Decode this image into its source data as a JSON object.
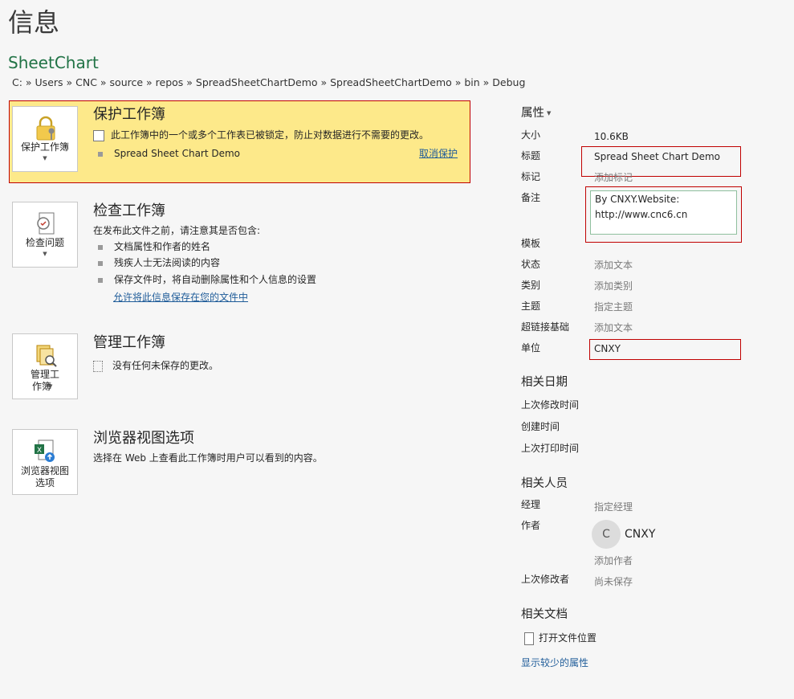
{
  "page": {
    "title": "信息"
  },
  "file": {
    "name": "SheetChart",
    "path": "C: » Users » CNC » source » repos » SpreadSheetChartDemo » SpreadSheetChartDemo » bin » Debug"
  },
  "protect": {
    "tile_label": "保护工作簿",
    "title": "保护工作簿",
    "message": "此工作簿中的一个或多个工作表已被锁定，防止对数据进行不需要的更改。",
    "sheet_name": "Spread Sheet Chart Demo",
    "unprotect_link": "取消保护"
  },
  "inspect": {
    "tile_label": "检查问题",
    "title": "检查工作簿",
    "intro": "在发布此文件之前，请注意其是否包含:",
    "items": [
      "文档属性和作者的姓名",
      "残疾人士无法阅读的内容",
      "保存文件时，将自动删除属性和个人信息的设置"
    ],
    "link": "允许将此信息保存在您的文件中"
  },
  "manage": {
    "tile_label_line1": "管理工",
    "tile_label_line2": "作簿",
    "title": "管理工作簿",
    "status": "没有任何未保存的更改。"
  },
  "browser": {
    "tile_label_line1": "浏览器视图",
    "tile_label_line2": "选项",
    "title": "浏览器视图选项",
    "description": "选择在 Web 上查看此工作簿时用户可以看到的内容。"
  },
  "properties": {
    "header": "属性",
    "size_label": "大小",
    "size_value": "10.6KB",
    "title_label": "标题",
    "title_value": "Spread Sheet Chart Demo",
    "tags_label": "标记",
    "tags_hint": "添加标记",
    "comments_label": "备注",
    "comments_value": "By CNXY.Website:\nhttp://www.cnc6.cn",
    "template_label": "模板",
    "status_label": "状态",
    "status_hint": "添加文本",
    "category_label": "类别",
    "category_hint": "添加类别",
    "subject_label": "主题",
    "subject_hint": "指定主题",
    "hyperlink_label": "超链接基础",
    "hyperlink_hint": "添加文本",
    "company_label": "单位",
    "company_value": "CNXY"
  },
  "dates": {
    "header": "相关日期",
    "modified": "上次修改时间",
    "created": "创建时间",
    "printed": "上次打印时间"
  },
  "people": {
    "header": "相关人员",
    "manager_label": "经理",
    "manager_hint": "指定经理",
    "author_label": "作者",
    "author_initial": "C",
    "author_name": "CNXY",
    "add_author": "添加作者",
    "last_modified_by_label": "上次修改者",
    "last_modified_by_value": "尚未保存"
  },
  "docs": {
    "header": "相关文档",
    "open_location": "打开文件位置",
    "show_fewer": "显示较少的属性"
  },
  "colors": {
    "accent_green": "#217346",
    "warn_yellow": "#fde98a",
    "highlight_red": "#c00000",
    "link_blue": "#1f5c99"
  }
}
